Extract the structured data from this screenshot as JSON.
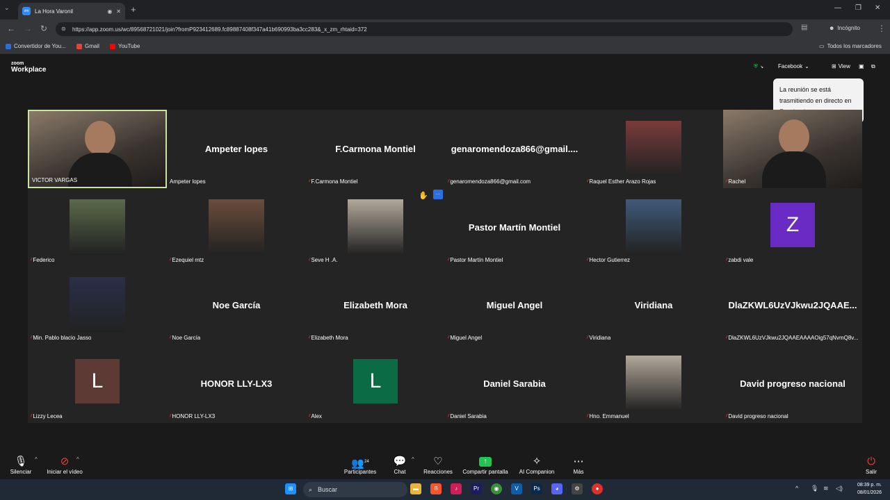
{
  "browser": {
    "tab_title": "La Hora Varonil",
    "url": "https://app.zoom.us/wc/89568721021/join?fromP923412689.fc89887408f347a41b690993ba3cc283&_x_zm_rhtaid=372",
    "incognito_label": "Incógnito",
    "bookmarks": [
      "Convertidor de You...",
      "Gmail",
      "YouTube"
    ],
    "all_bookmarks": "Todos los marcadores"
  },
  "zoom": {
    "logo_top": "zoom",
    "logo_bottom": "Workplace",
    "stream_label": "Facebook",
    "view_label": "View",
    "tooltip": "La reunión se está trasmitiendo en directo en Facebook"
  },
  "participants": [
    {
      "label": "VICTOR VARGAS",
      "big": "",
      "video": true,
      "muted": false,
      "active": true
    },
    {
      "label": "Ampeter lopes",
      "big": "Ampeter lopes",
      "muted": false
    },
    {
      "label": "F.Carmona Montiel",
      "big": "F.Carmona Montiel",
      "muted": true
    },
    {
      "label": "genaromendoza866@gmail.com",
      "big": "genaromendoza866@gmail....",
      "muted": true
    },
    {
      "label": "Raquel Esther Arazo Rojas",
      "big": "",
      "photo": true,
      "muted": true
    },
    {
      "label": "Rachel",
      "big": "",
      "video": true,
      "muted": true
    },
    {
      "label": "Federico",
      "big": "",
      "photo": true,
      "muted": true
    },
    {
      "label": "Ezequiel mtz",
      "big": "",
      "photo": true,
      "muted": true
    },
    {
      "label": "Seve H .A.",
      "big": "",
      "photo": true,
      "muted": true
    },
    {
      "label": "Pastor Martín Montiel",
      "big": "Pastor Martín Montiel",
      "muted": true
    },
    {
      "label": "Hector Gutierrez",
      "big": "",
      "photo": true,
      "muted": true
    },
    {
      "label": "zabdi vale",
      "big": "",
      "letter": "Z",
      "letter_color": "#6a2bc4",
      "muted": true
    },
    {
      "label": "Min. Pablo blacio Jasso",
      "big": "",
      "photo": true,
      "muted": true
    },
    {
      "label": "Noe García",
      "big": "Noe García",
      "muted": true
    },
    {
      "label": "Elizabeth Mora",
      "big": "Elizabeth Mora",
      "muted": true
    },
    {
      "label": "Miguel Angel",
      "big": "Miguel Angel",
      "muted": true
    },
    {
      "label": "Viridiana",
      "big": "Viridiana",
      "muted": true
    },
    {
      "label": "DlaZKWL6UzVJkwu2JQAAEAAAAOig57qNvmQ8v...",
      "big": "DlaZKWL6UzVJkwu2JQAAE...",
      "muted": true
    },
    {
      "label": "Lizzy Lecea",
      "big": "",
      "letter": "L",
      "letter_color": "#5e3a34",
      "muted": true
    },
    {
      "label": "HONOR LLY-LX3",
      "big": "HONOR LLY-LX3",
      "muted": true
    },
    {
      "label": "Alex",
      "big": "",
      "letter": "L",
      "letter_color": "#0b6b45",
      "muted": true
    },
    {
      "label": "Daniel Sarabia",
      "big": "Daniel Sarabia",
      "muted": true
    },
    {
      "label": "Hno. Emmanuel",
      "big": "",
      "photo": true,
      "muted": true
    },
    {
      "label": "David progreso nacional",
      "big": "David progreso nacional",
      "muted": true
    }
  ],
  "toolbar": {
    "mute": "Silenciar",
    "video": "Iniciar el vídeo",
    "participants": "Participantes",
    "participants_count": "24",
    "chat": "Chat",
    "reactions": "Reacciones",
    "share": "Compartir pantalla",
    "ai": "AI Companion",
    "more": "Más",
    "leave": "Salir"
  },
  "taskbar": {
    "search": "Buscar",
    "time": "08:39 p. m.",
    "date": "08/01/2026"
  }
}
